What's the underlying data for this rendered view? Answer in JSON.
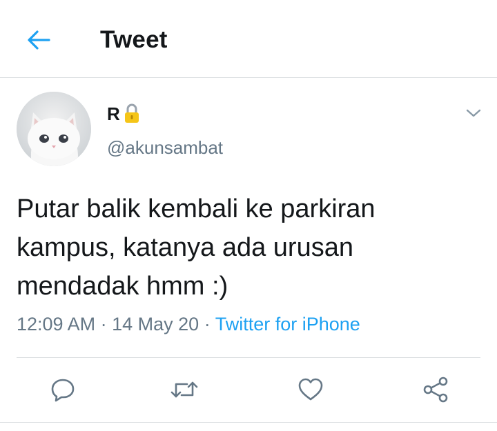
{
  "header": {
    "back_icon": "arrow-left-icon",
    "title": "Tweet"
  },
  "tweet": {
    "author": {
      "display_name": "R",
      "badge_icon": "lock-icon",
      "handle": "@akunsambat",
      "avatar": "white-cat-avatar"
    },
    "text": "Putar balik kembali ke parkiran kampus, katanya ada urusan mendadak hmm :)",
    "time": "12:09 AM",
    "separator": "·",
    "date": "14 May 20",
    "source": "Twitter for iPhone"
  },
  "actions": [
    {
      "name": "reply",
      "icon": "reply-icon"
    },
    {
      "name": "retweet",
      "icon": "retweet-icon"
    },
    {
      "name": "like",
      "icon": "heart-icon"
    },
    {
      "name": "share",
      "icon": "share-icon"
    }
  ],
  "colors": {
    "accent": "#1da1f2",
    "text_primary": "#14171a",
    "text_secondary": "#657786",
    "divider": "#dcdfe2",
    "icon_gray": "#657786",
    "lock_gold": "#f5c518"
  }
}
